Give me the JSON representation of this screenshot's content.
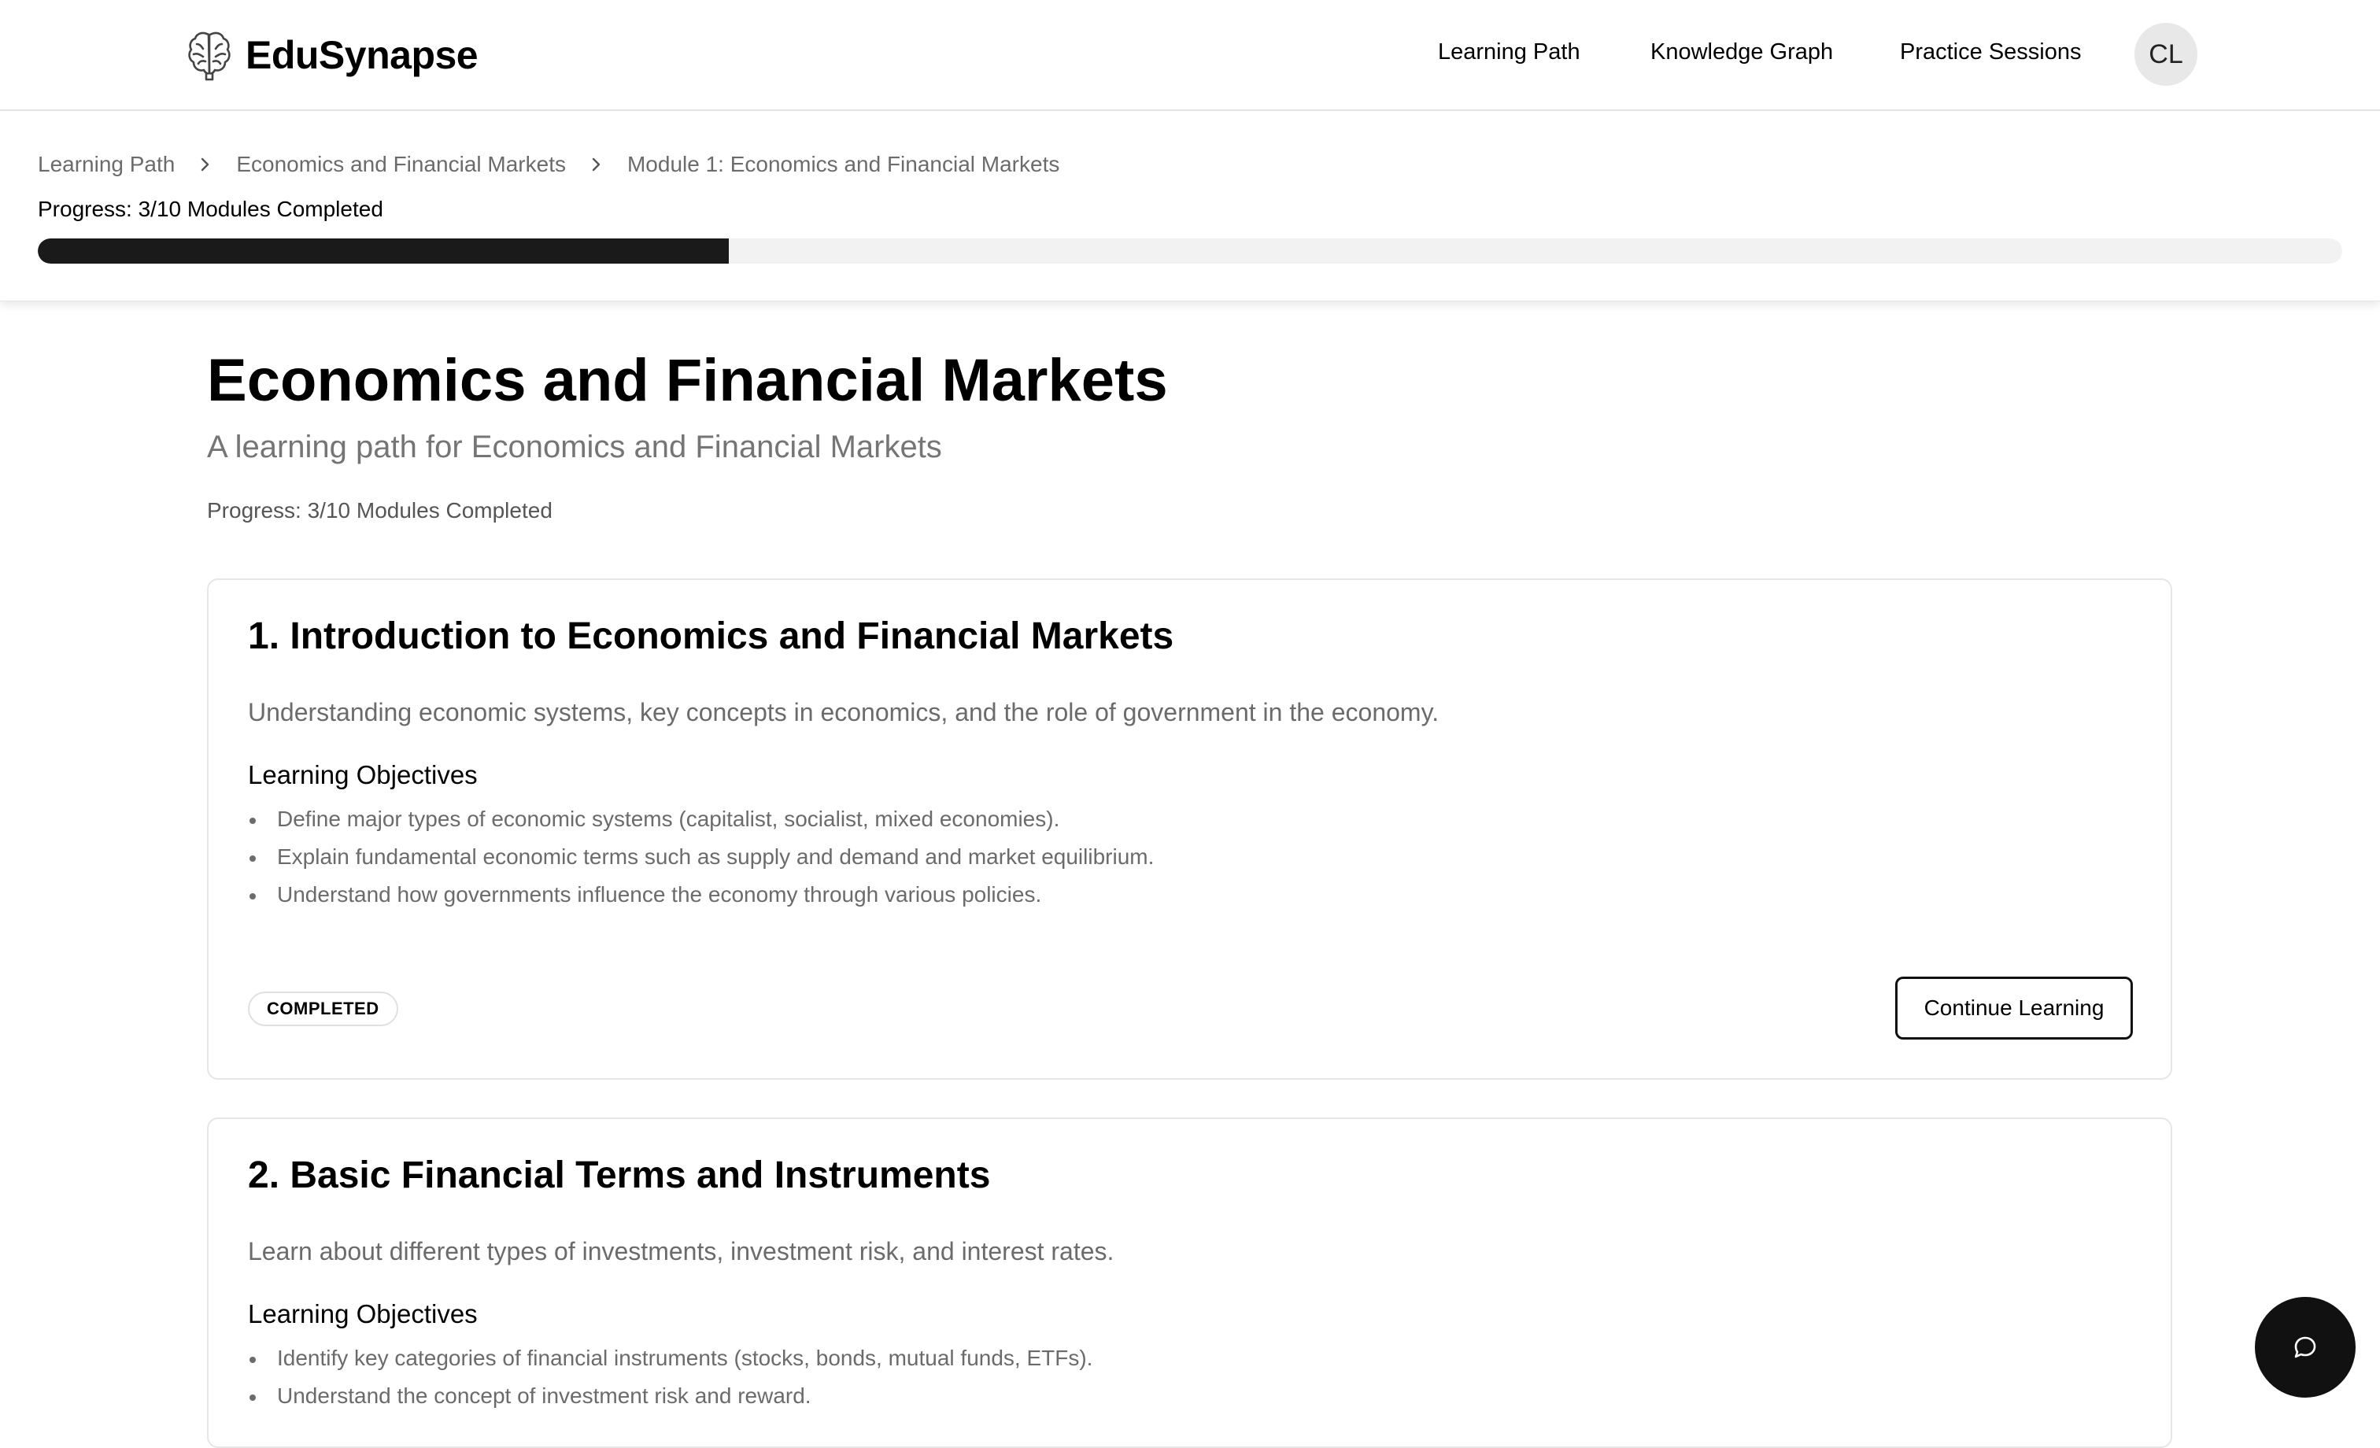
{
  "header": {
    "logo_text": "EduSynapse",
    "logo_icon": "brain-icon",
    "nav": [
      "Learning Path",
      "Knowledge Graph",
      "Practice Sessions"
    ],
    "avatar_initials": "CL"
  },
  "breadcrumb": {
    "items": [
      "Learning Path",
      "Economics and Financial Markets",
      "Module 1: Economics and Financial Markets"
    ],
    "progress_text": "Progress: 3/10 Modules Completed",
    "progress_fraction": 0.3
  },
  "page": {
    "title": "Economics and Financial Markets",
    "subtitle": "A learning path for Economics and Financial Markets",
    "progress_text": "Progress: 3/10 Modules Completed"
  },
  "modules": [
    {
      "title": "1. Introduction to Economics and Financial Markets",
      "description": "Understanding economic systems, key concepts in economics, and the role of government in the economy.",
      "objectives_heading": "Learning Objectives",
      "objectives": [
        "Define major types of economic systems (capitalist, socialist, mixed economies).",
        "Explain fundamental economic terms such as supply and demand and market equilibrium.",
        "Understand how governments influence the economy through various policies."
      ],
      "status": "COMPLETED",
      "action_label": "Continue Learning"
    },
    {
      "title": "2. Basic Financial Terms and Instruments",
      "description": "Learn about different types of investments, investment risk, and interest rates.",
      "objectives_heading": "Learning Objectives",
      "objectives": [
        "Identify key categories of financial instruments (stocks, bonds, mutual funds, ETFs).",
        "Understand the concept of investment risk and reward."
      ]
    }
  ],
  "chat": {
    "icon": "chat-bubble-icon"
  },
  "colors": {
    "accent": "#1a1a1a",
    "muted_text": "#6b6b6b",
    "border": "#e6e6e6",
    "progress_track": "#f2f2f2"
  }
}
